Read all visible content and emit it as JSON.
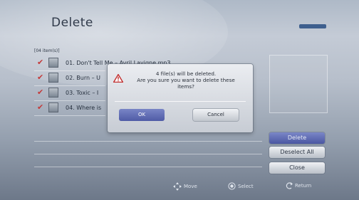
{
  "screen": {
    "title": "Delete",
    "item_count": "[04 item(s)]"
  },
  "files": [
    {
      "label": "01. Don't Tell Me – Avril Lavigne.mp3",
      "checked": true
    },
    {
      "label": "02. Burn – U",
      "checked": true
    },
    {
      "label": "03. Toxic – I",
      "checked": true
    },
    {
      "label": "04. Where is",
      "checked": true
    }
  ],
  "dialog": {
    "line1": "4 file(s) will be deleted.",
    "line2": "Are you sure you want to delete these",
    "line3": "items?",
    "ok_label": "OK",
    "cancel_label": "Cancel"
  },
  "side_buttons": {
    "delete_label": "Delete",
    "deselect_all_label": "Deselect All",
    "close_label": "Close"
  },
  "footer": {
    "move_label": "Move",
    "select_label": "Select",
    "return_label": "Return"
  },
  "icons": {
    "check": "check-icon",
    "file": "file-icon",
    "warning": "warning-icon",
    "move": "move-icon",
    "select": "select-icon",
    "return": "return-icon"
  },
  "colors": {
    "accent": "#4a56a2",
    "check": "#c43a3a",
    "brand": "#3e5f8e"
  }
}
